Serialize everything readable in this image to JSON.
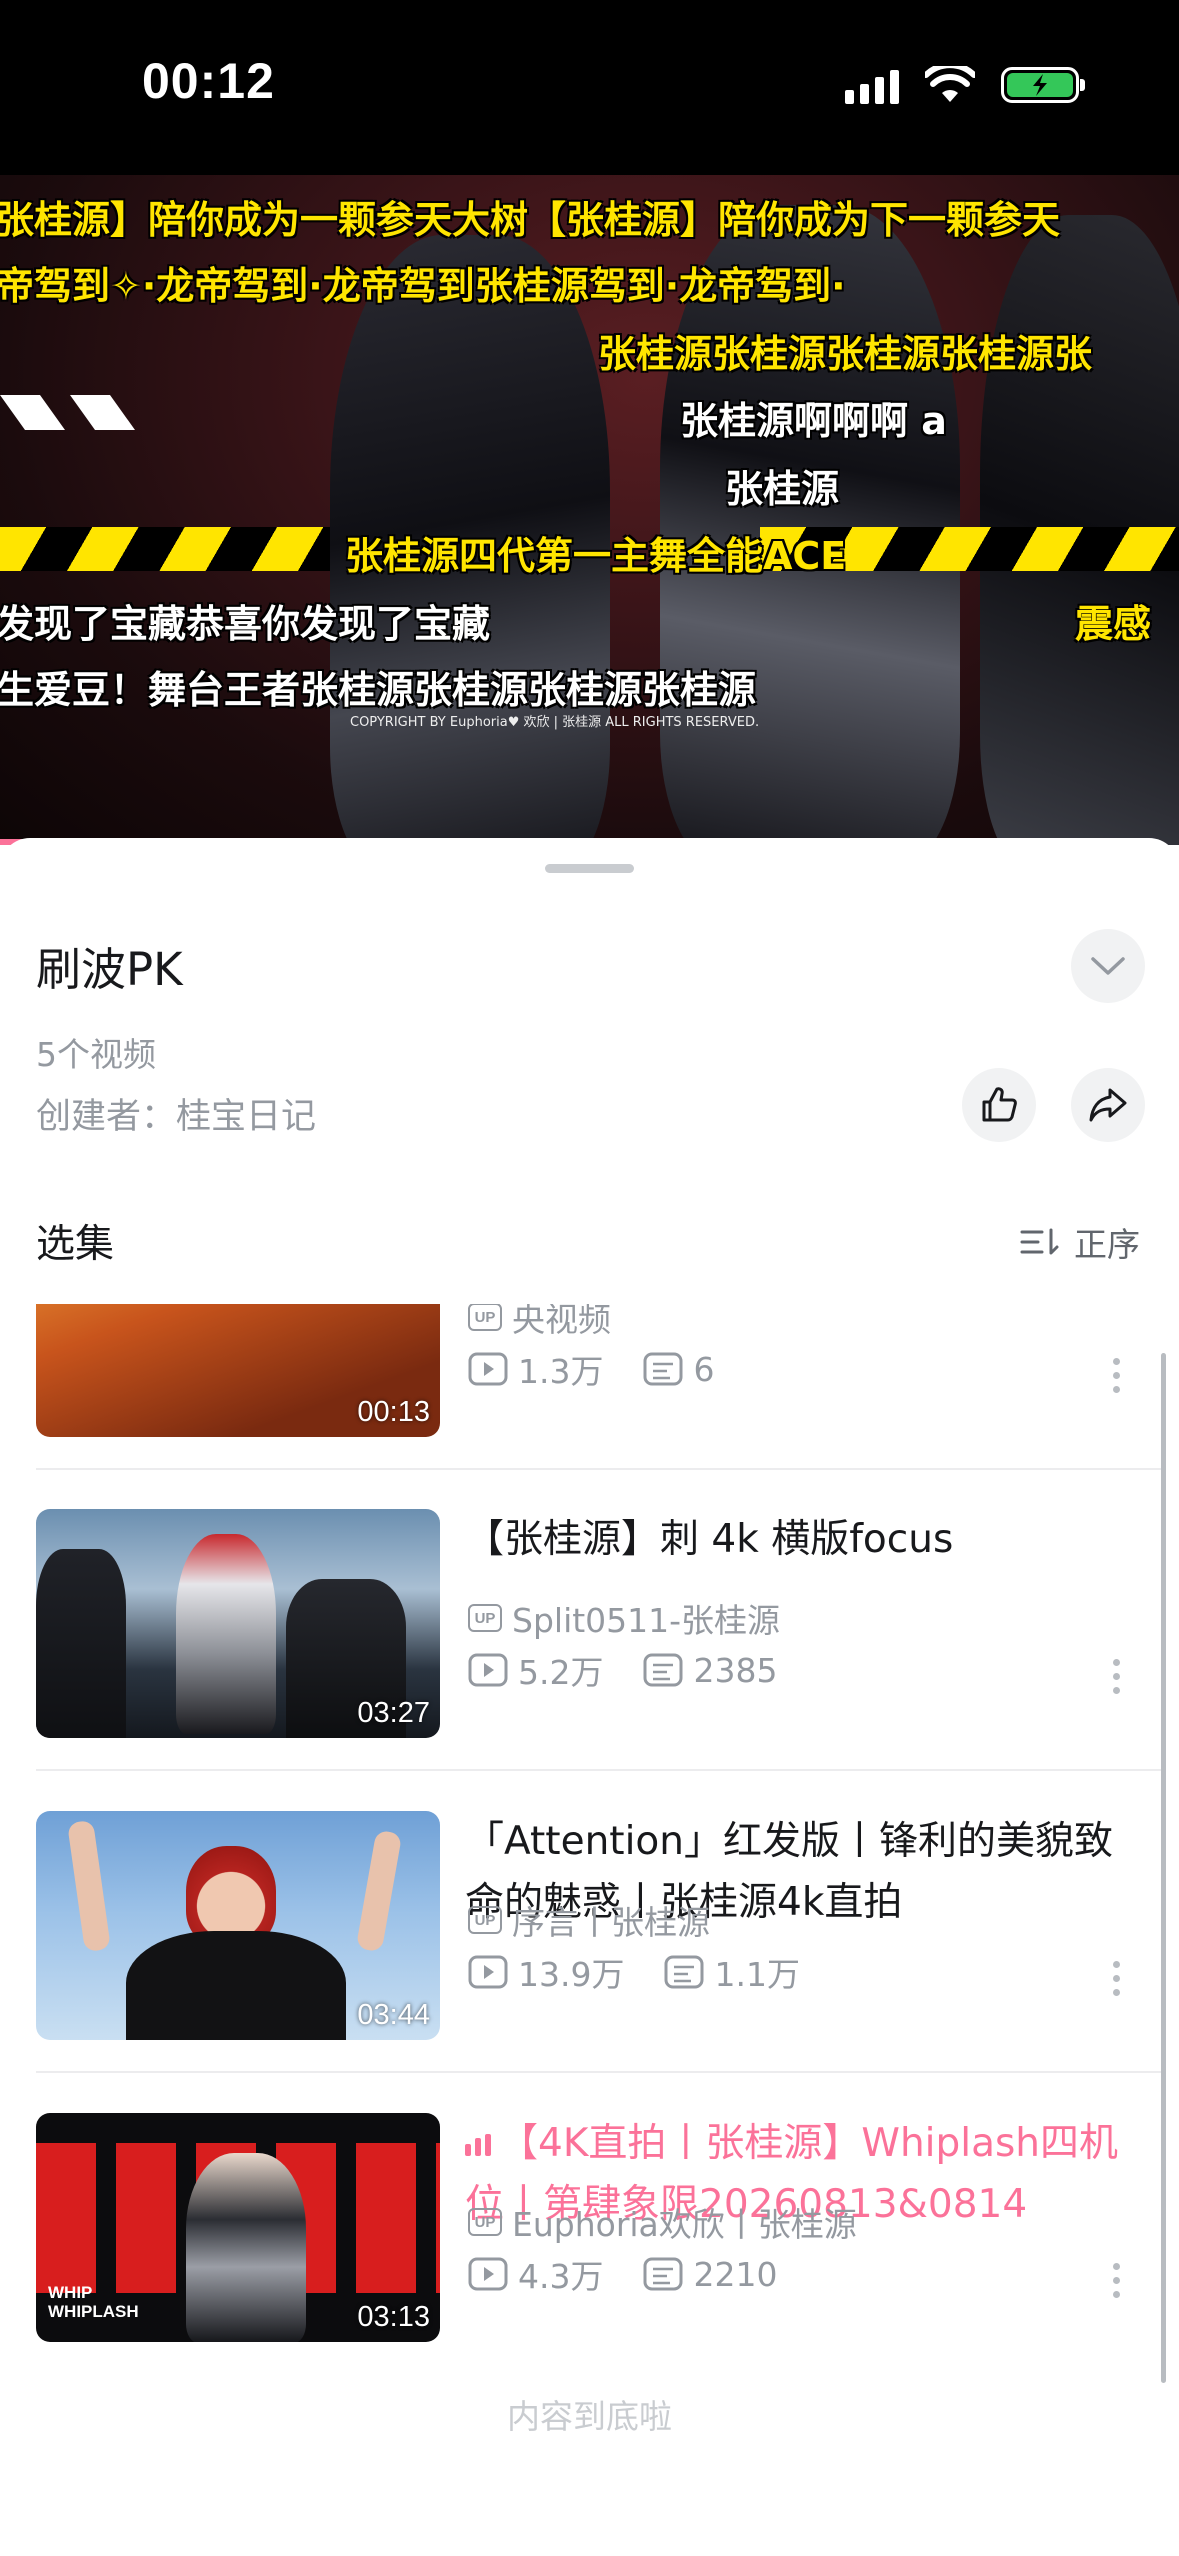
{
  "status_bar": {
    "time": "00:12",
    "icons": [
      "cellular-signal-icon",
      "wifi-icon",
      "battery-charging-icon"
    ],
    "battery_color": "#34c759"
  },
  "video": {
    "danmaku": [
      "张桂源】陪你成为一颗参天大树【张桂源】陪你成为下一颗参天",
      "帝驾到✧·龙帝驾到·龙帝驾到张桂源驾到·龙帝驾到·",
      "张桂源张桂源张桂源张桂源张",
      "张桂源啊啊啊 a",
      "张桂源",
      "张桂源四代第一主舞全能ACE",
      "发现了宝藏恭喜你发现了宝藏",
      "震感",
      "生爱豆！舞台王者张桂源张桂源张桂源张桂源"
    ],
    "copyright": "COPYRIGHT BY  Euphoria♥ 欢欣 | 张桂源   ALL RIGHTS RESERVED."
  },
  "collection": {
    "title": "刷波PK",
    "video_count": "5个视频",
    "creator": "创建者：桂宝日记"
  },
  "episodes": {
    "label": "选集",
    "sort_label": "正序",
    "items": [
      {
        "duration": "00:13",
        "title": "",
        "uploader": "央视频",
        "views": "1.3万",
        "comments": "6",
        "playing": false
      },
      {
        "duration": "03:27",
        "title": "【张桂源】刺 4k 横版focus",
        "uploader": "Split0511-张桂源",
        "views": "5.2万",
        "comments": "2385",
        "playing": false
      },
      {
        "duration": "03:44",
        "title": "「Attention」红发版丨锋利的美貌致命的魅惑丨张桂源4k直拍",
        "uploader": "序言丨张桂源",
        "views": "13.9万",
        "comments": "1.1万",
        "playing": false
      },
      {
        "duration": "03:13",
        "title": "【4K直拍丨张桂源】Whiplash四机位丨第肆象限20260813&0814",
        "uploader": "Euphoria欢欣丨张桂源",
        "views": "4.3万",
        "comments": "2210",
        "playing": true
      }
    ],
    "end_text": "内容到底啦"
  },
  "accent_color": "#fb7299"
}
